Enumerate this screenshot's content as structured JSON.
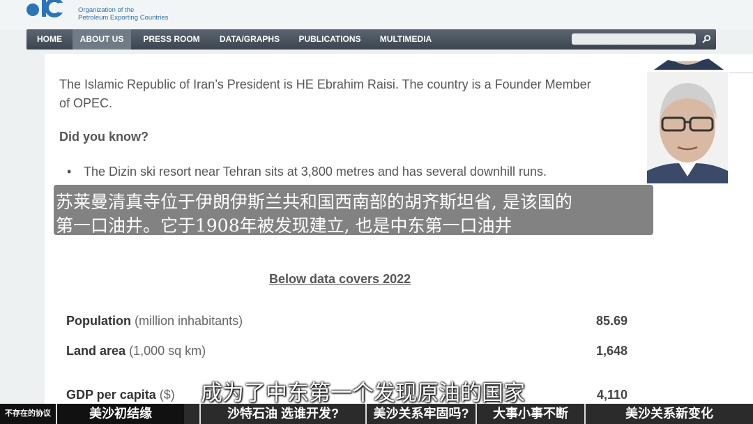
{
  "org": {
    "line1": "Organization of the",
    "line2": "Petroleum Exporting Countries"
  },
  "nav": {
    "items": [
      "HOME",
      "ABOUT US",
      "PRESS ROOM",
      "DATA/GRAPHS",
      "PUBLICATIONS",
      "MULTIMEDIA"
    ],
    "active": "ABOUT US"
  },
  "content": {
    "p1": "The Islamic Republic of Iran’s President is HE Ebrahim Raisi. The country is a Founder Member of OPEC.",
    "did_you_know": "Did you know?",
    "bullet1": "The Dizin ski resort near Tehran sits at 3,800 metres and has several downhill runs.",
    "covers": "Below data covers 2022",
    "rows": [
      {
        "label": "Population",
        "unit": "(million inhabitants)",
        "value": "85.69"
      },
      {
        "label": "Land area",
        "unit": "(1,000 sq km)",
        "value": "1,648"
      },
      {
        "label": "GDP per capita",
        "unit": "($)",
        "value": "4,110"
      }
    ]
  },
  "caption": {
    "line1": "苏莱曼清真寺位于伊朗伊斯兰共和国西南部的胡齐斯坦省, 是该国的",
    "line2": "第一口油井。它于1908年被发现建立, 也是中东第一口油井"
  },
  "subtitle": "成为了中东第一个发现原油的国家",
  "chapters": [
    "不存在的协议",
    "美沙初结缘",
    "沙特石油 选谁开发?",
    "美沙关系牢固吗?",
    "大事小事不断",
    "美沙关系新变化"
  ],
  "colors": {
    "nav_bg": "#4a545f",
    "org_text": "#2f6fa6",
    "chapter_bg": "#2b2b2b"
  }
}
